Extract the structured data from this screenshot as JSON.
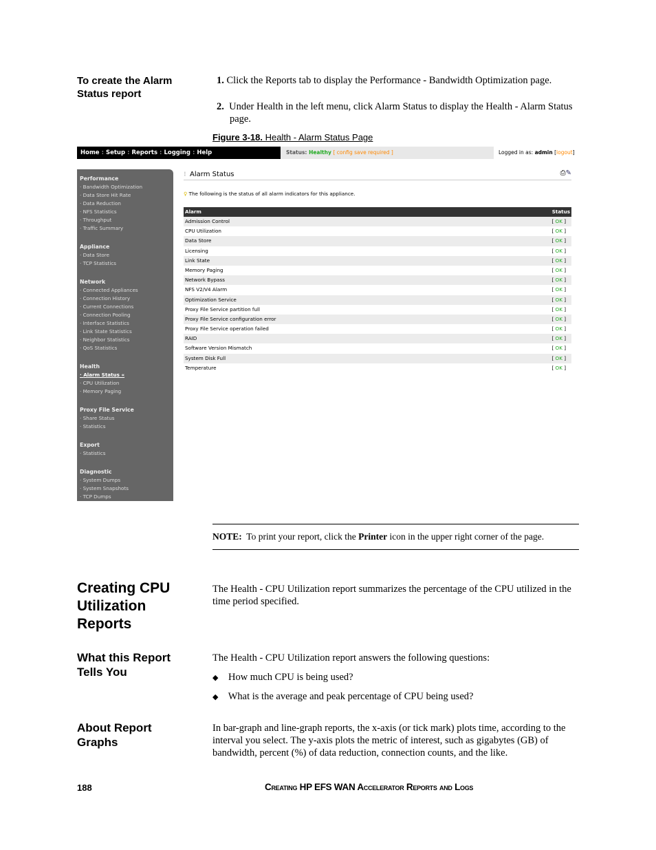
{
  "procedure": {
    "heading": "To create the Alarm Status report",
    "steps": [
      {
        "num": "1.",
        "text": "Click the Reports tab to display the Performance - Bandwidth Optimization page."
      },
      {
        "num": "2.",
        "text": "Under Health in the left menu, click Alarm Status to display the Health - Alarm Status page."
      }
    ]
  },
  "figure": {
    "label": "Figure 3-18.",
    "caption": " Health - Alarm Status Page"
  },
  "ui": {
    "nav": [
      "Home",
      "Setup",
      "Reports",
      "Logging",
      "Help"
    ],
    "status_label": "Status:",
    "status_value": "Healthy",
    "status_note": "[ config save required ]",
    "logged_in_label": "Logged in as:",
    "user": "admin",
    "logout": "logout",
    "colors": {
      "healthy": "#22aa22",
      "note": "#ff8800",
      "nav_bg": "#000000",
      "sidebar_bg": "#666666"
    },
    "sidebar": [
      {
        "title": "Performance",
        "items": [
          "Bandwidth Optimization",
          "Data Store Hit Rate",
          "Data Reduction",
          "NFS Statistics",
          "Throughput",
          "Traffic Summary"
        ]
      },
      {
        "title": "Appliance",
        "items": [
          "Data Store",
          "TCP Statistics"
        ]
      },
      {
        "title": "Network",
        "items": [
          "Connected Appliances",
          "Connection History",
          "Current Connections",
          "Connection Pooling",
          "Interface Statistics",
          "Link State Statistics",
          "Neighbor Statistics",
          "QoS Statistics"
        ]
      },
      {
        "title": "Health",
        "items": [
          "Alarm Status «",
          "CPU Utilization",
          "Memory Paging"
        ],
        "active": 0
      },
      {
        "title": "Proxy File Service",
        "items": [
          "Share Status",
          "Statistics"
        ]
      },
      {
        "title": "Export",
        "items": [
          "Statistics"
        ]
      },
      {
        "title": "Diagnostic",
        "items": [
          "System Dumps",
          "System Snapshots",
          "TCP Dumps"
        ]
      }
    ],
    "page_title": "Alarm Status",
    "info": "The following is the status of all alarm indicators for this appliance.",
    "table": {
      "headers": [
        "Alarm",
        "Status"
      ],
      "rows": [
        [
          "Admission Control",
          "OK"
        ],
        [
          "CPU Utilization",
          "OK"
        ],
        [
          "Data Store",
          "OK"
        ],
        [
          "Licensing",
          "OK"
        ],
        [
          "Link State",
          "OK"
        ],
        [
          "Memory Paging",
          "OK"
        ],
        [
          "Network Bypass",
          "OK"
        ],
        [
          "NFS V2/V4 Alarm",
          "OK"
        ],
        [
          "Optimization Service",
          "OK"
        ],
        [
          "Proxy File Service partition full",
          "OK"
        ],
        [
          "Proxy File Service configuration error",
          "OK"
        ],
        [
          "Proxy File Service operation failed",
          "OK"
        ],
        [
          "RAID",
          "OK"
        ],
        [
          "Software Version Mismatch",
          "OK"
        ],
        [
          "System Disk Full",
          "OK"
        ],
        [
          "Temperature",
          "OK"
        ]
      ]
    }
  },
  "note": {
    "label": "NOTE:",
    "pre": "To print your report, click the ",
    "bold": "Printer",
    "post": " icon in the upper right corner of the page."
  },
  "sections": {
    "cpu_heading": "Creating CPU Utilization Reports",
    "cpu_text": "The Health - CPU Utilization report summarizes the percentage of the CPU utilized in the time period specified.",
    "what_heading": "What this Report Tells You",
    "what_text": "The Health - CPU Utilization report answers the following questions:",
    "bullets": [
      "How much CPU is being used?",
      "What is the average and peak percentage of CPU being used?"
    ],
    "about_heading": "About Report Graphs",
    "about_text": "In bar-graph and line-graph reports, the x-axis (or tick mark) plots time, according to the interval you select. The y-axis plots the metric of interest, such as gigabytes (GB) of bandwidth, percent (%) of data reduction, connection counts, and the like."
  },
  "footer": {
    "page": "188",
    "title": "Creating HP EFS WAN Accelerator Reports and Logs"
  }
}
